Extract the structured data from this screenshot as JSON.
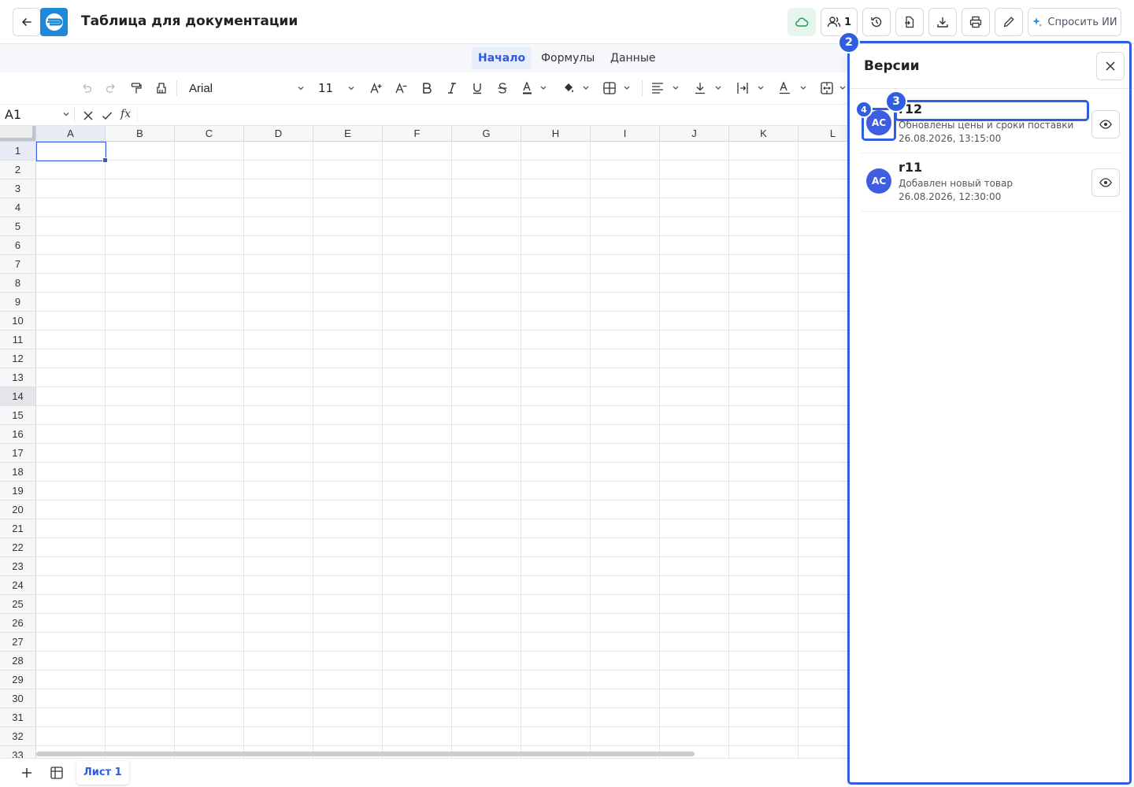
{
  "header": {
    "title": "Таблица для документации",
    "collaborators_count": "1",
    "ask_ai_label": "Спросить ИИ",
    "accent_color": "#2e5bdb",
    "cloud_status_color": "#1f9d55"
  },
  "menu": {
    "tabs": [
      {
        "label": "Начало",
        "active": true
      },
      {
        "label": "Формулы",
        "active": false
      },
      {
        "label": "Данные",
        "active": false
      }
    ]
  },
  "toolbar": {
    "font_family": "Arial",
    "font_size": "11"
  },
  "formula_bar": {
    "cell_ref": "A1",
    "fx_label": "fx",
    "value": ""
  },
  "grid": {
    "columns": [
      "A",
      "B",
      "C",
      "D",
      "E",
      "F",
      "G",
      "H",
      "I",
      "J",
      "K",
      "L"
    ],
    "rows": [
      "1",
      "2",
      "3",
      "4",
      "5",
      "6",
      "7",
      "8",
      "9",
      "10",
      "11",
      "12",
      "13",
      "14",
      "15",
      "16",
      "17",
      "18",
      "19",
      "20",
      "21",
      "22",
      "23",
      "24",
      "25",
      "26",
      "27",
      "28",
      "29",
      "30",
      "31",
      "32",
      "33"
    ],
    "selected_cell": "A1",
    "highlighted_row": "14"
  },
  "sheets": {
    "tabs": [
      {
        "label": "Лист 1",
        "active": true
      }
    ]
  },
  "versions_panel": {
    "title": "Версии",
    "items": [
      {
        "name": "r12",
        "avatar": "AC",
        "description": "Обновлены цены и сроки поставки",
        "date": "26.08.2026, 13:15:00"
      },
      {
        "name": "r11",
        "avatar": "AC",
        "description": "Добавлен новый товар",
        "date": "26.08.2026, 12:30:00"
      }
    ]
  },
  "annotations": {
    "badges": [
      "2",
      "3",
      "4"
    ],
    "color": "#2f5fe0"
  }
}
